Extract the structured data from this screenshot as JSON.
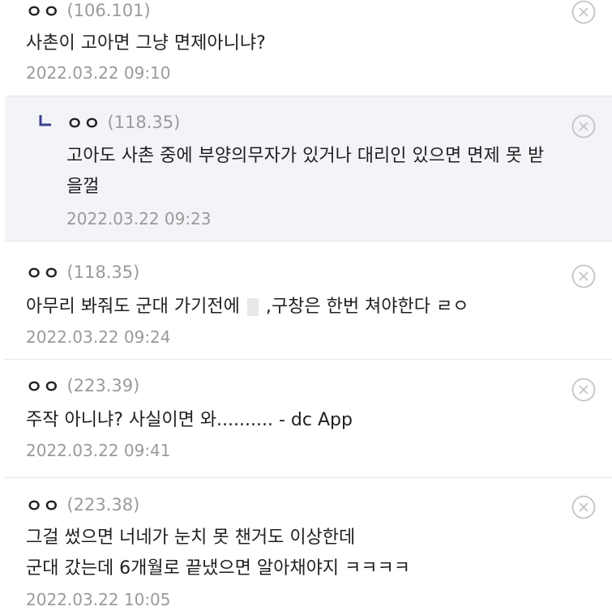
{
  "comments": [
    {
      "nick": "ㅇㅇ",
      "ip": "(106.101)",
      "lines": [
        "사촌이 고아면 그냥 면제아니냐?"
      ],
      "date": "2022.03.22 09:10"
    },
    {
      "nick": "ㅇㅇ",
      "ip": "(118.35)",
      "lines": [
        "고아도 사촌 중에 부양의무자가 있거나 대리인 있으면 면제 못 받",
        "을껄"
      ],
      "date": "2022.03.22 09:23",
      "is_reply": true
    },
    {
      "nick": "ㅇㅇ",
      "ip": "(118.35)",
      "line_before_mask": "아무리 봐줘도 군대 가기전에",
      "line_after_mask": ",구창은 한번 쳐야한다 ㄹㅇ",
      "date": "2022.03.22 09:24"
    },
    {
      "nick": "ㅇㅇ",
      "ip": "(223.39)",
      "lines": [
        "주작 아니냐? 사실이면 와.......... - dc App"
      ],
      "date": "2022.03.22 09:41"
    },
    {
      "nick": "ㅇㅇ",
      "ip": "(223.38)",
      "lines": [
        "그걸 썼으면 너네가 눈치 못 챈거도 이상한데",
        "군대 갔는데 6개월로 끝냈으면 알아채야지 ㅋㅋㅋㅋ"
      ],
      "date": "2022.03.22 10:05"
    }
  ],
  "icons": {
    "delete": "close-circle-icon",
    "reply": "reply-arrow-icon"
  },
  "colors": {
    "reply_background": "#f3f4f8",
    "reply_icon": "#3b3f8f",
    "meta_text": "#9a9a9a"
  }
}
